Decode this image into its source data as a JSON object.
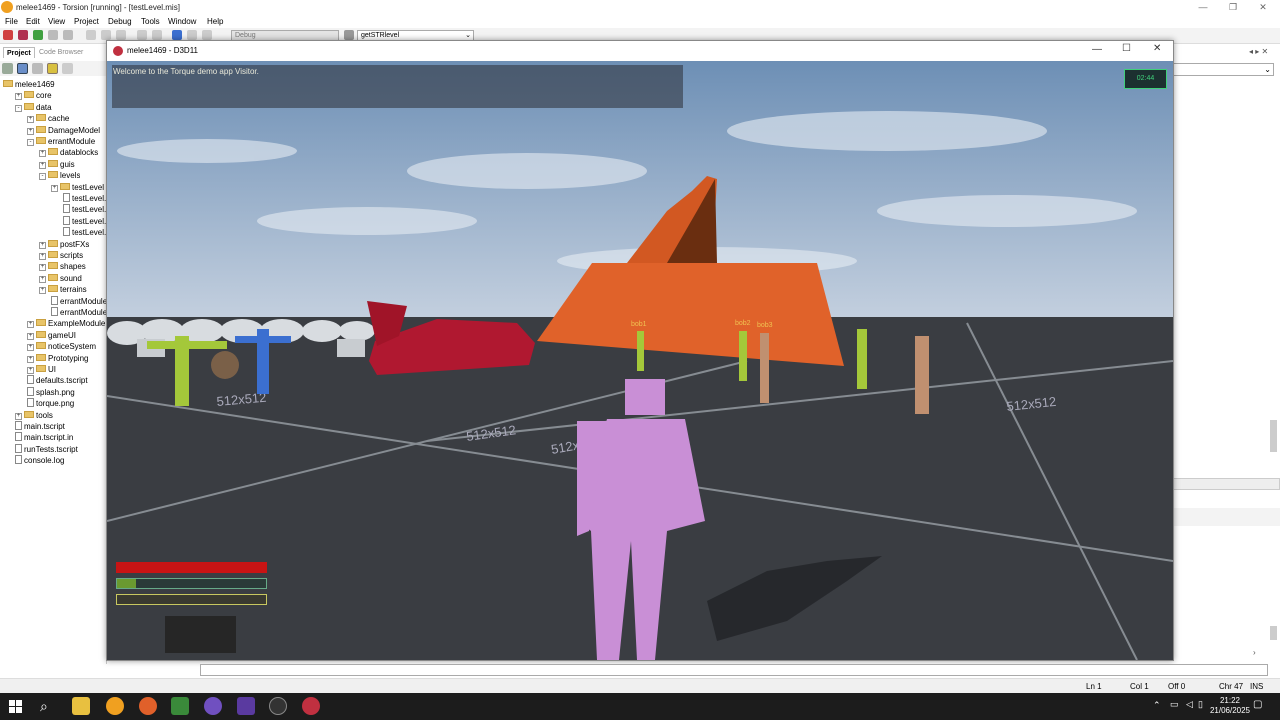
{
  "app": {
    "title": "melee1469 - Torsion [running] - [testLevel.mis]",
    "menu": [
      "File",
      "Edit",
      "View",
      "Project",
      "Debug",
      "Tools",
      "Window",
      "Help"
    ],
    "config": "Debug",
    "function_combo": "getSTRlevel"
  },
  "project_panel": {
    "tabs": [
      "Project",
      "Code Browser"
    ],
    "tree": [
      {
        "label": "melee1469",
        "depth": 0,
        "kind": "root",
        "expander": ""
      },
      {
        "label": "core",
        "depth": 1,
        "kind": "folder",
        "expander": "+"
      },
      {
        "label": "data",
        "depth": 1,
        "kind": "folder",
        "expander": "-"
      },
      {
        "label": "cache",
        "depth": 2,
        "kind": "folder",
        "expander": "+"
      },
      {
        "label": "DamageModel",
        "depth": 2,
        "kind": "folder",
        "expander": "+"
      },
      {
        "label": "errantModule",
        "depth": 2,
        "kind": "folder",
        "expander": "-"
      },
      {
        "label": "datablocks",
        "depth": 3,
        "kind": "folder",
        "expander": "+"
      },
      {
        "label": "guis",
        "depth": 3,
        "kind": "folder",
        "expander": "+"
      },
      {
        "label": "levels",
        "depth": 3,
        "kind": "folder",
        "expander": "-"
      },
      {
        "label": "testLevel",
        "depth": 4,
        "kind": "folder",
        "expander": "+"
      },
      {
        "label": "testLevel.a",
        "depth": 5,
        "kind": "file",
        "expander": ""
      },
      {
        "label": "testLevel.m",
        "depth": 5,
        "kind": "file",
        "expander": ""
      },
      {
        "label": "testLevel.m",
        "depth": 5,
        "kind": "file",
        "expander": ""
      },
      {
        "label": "testLevel.p",
        "depth": 5,
        "kind": "file",
        "expander": ""
      },
      {
        "label": "postFXs",
        "depth": 3,
        "kind": "folder",
        "expander": "+"
      },
      {
        "label": "scripts",
        "depth": 3,
        "kind": "folder",
        "expander": "+"
      },
      {
        "label": "shapes",
        "depth": 3,
        "kind": "folder",
        "expander": "+"
      },
      {
        "label": "sound",
        "depth": 3,
        "kind": "folder",
        "expander": "+"
      },
      {
        "label": "terrains",
        "depth": 3,
        "kind": "folder",
        "expander": "+"
      },
      {
        "label": "errantModule.",
        "depth": 4,
        "kind": "file",
        "expander": ""
      },
      {
        "label": "errantModule.",
        "depth": 4,
        "kind": "file",
        "expander": ""
      },
      {
        "label": "ExampleModule",
        "depth": 2,
        "kind": "folder",
        "expander": "+"
      },
      {
        "label": "gameUI",
        "depth": 2,
        "kind": "folder",
        "expander": "+"
      },
      {
        "label": "noticeSystem",
        "depth": 2,
        "kind": "folder",
        "expander": "+"
      },
      {
        "label": "Prototyping",
        "depth": 2,
        "kind": "folder",
        "expander": "+"
      },
      {
        "label": "UI",
        "depth": 2,
        "kind": "folder",
        "expander": "+"
      },
      {
        "label": "defaults.tscript",
        "depth": 2,
        "kind": "file",
        "expander": ""
      },
      {
        "label": "splash.png",
        "depth": 2,
        "kind": "file",
        "expander": ""
      },
      {
        "label": "torque.png",
        "depth": 2,
        "kind": "file",
        "expander": ""
      },
      {
        "label": "tools",
        "depth": 1,
        "kind": "folder",
        "expander": "+"
      },
      {
        "label": "main.tscript",
        "depth": 1,
        "kind": "file",
        "expander": ""
      },
      {
        "label": "main.tscript.in",
        "depth": 1,
        "kind": "file",
        "expander": ""
      },
      {
        "label": "runTests.tscript",
        "depth": 1,
        "kind": "file",
        "expander": ""
      },
      {
        "label": "console.log",
        "depth": 1,
        "kind": "file",
        "expander": ""
      }
    ]
  },
  "game_window": {
    "title": "melee1469 - D3D11",
    "welcome": "Welcome to the Torque demo app Visitor.",
    "timer": "02:44",
    "npc_labels": [
      "bob1",
      "bob2",
      "bob3"
    ],
    "floor_labels": [
      "512x512",
      "512x512",
      "512x512",
      "512x512"
    ],
    "health": 1.0,
    "stamina": 0.13,
    "third_bar": 0.0
  },
  "status": {
    "line": "Ln 1",
    "col": "Col 1",
    "off": "Off 0",
    "chr": "Chr 47",
    "mode": "INS"
  },
  "taskbar": {
    "time": "21:22",
    "date": "21/06/2025"
  },
  "colors": {
    "sky_top": "#6d8fb5",
    "ground": "#3a3d42",
    "pyramid": "#e0622a",
    "player": "#c98fd6",
    "car": "#b01830",
    "green_npc": "#a4c83a",
    "tan_npc": "#c09070",
    "timer_accent": "#3fd07a",
    "health": "#c81414"
  }
}
